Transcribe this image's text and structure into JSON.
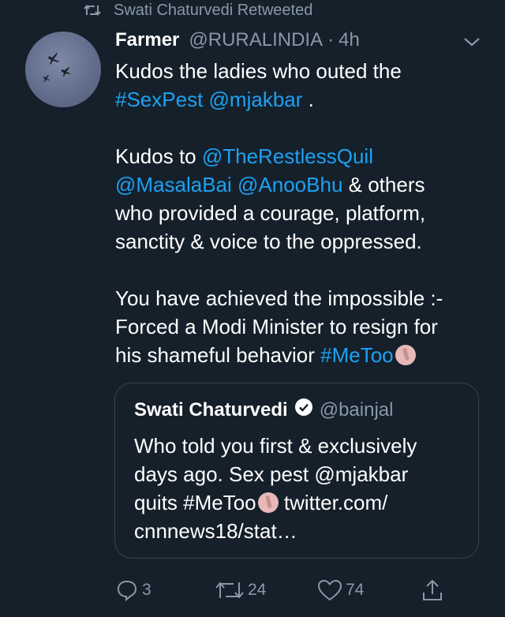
{
  "retweet_context": {
    "label": "Swati Chaturvedi Retweeted",
    "icon": "retweet-icon"
  },
  "tweet": {
    "author_name": "Farmer",
    "author_handle": "@RURALINDIA",
    "separator": "·",
    "time": "4h",
    "menu_icon": "chevron-down-icon",
    "lines": {
      "l1": "Kudos the ladies who outed the",
      "l2_tag": "#SexPest",
      "l2_mention": "@mjakbar",
      "l2_tail": " .",
      "l3_mention": "@TheRestlessQuil",
      "l3_lead": "Kudos to ",
      "l4_mention1": "@MasalaBai",
      "l4_mention2": "@AnooBhu",
      "l4_tail": " & others",
      "l5": "who provided a courage, platform,",
      "l6": "sanctity & voice to the oppressed.",
      "l7": "You have achieved the impossible :-",
      "l8": "Forced a Modi Minister to resign for",
      "l9_lead": "his shameful behavior ",
      "l9_tag": "#MeToo"
    }
  },
  "quoted_tweet": {
    "author_name": "Swati Chaturvedi",
    "author_handle": "@bainjal",
    "verified_icon": "verified-badge-icon",
    "lines": {
      "l1": "Who told you first & exclusively",
      "l2": "days ago. Sex pest @mjakbar",
      "l3_lead": "quits #MeToo",
      "l3_tail": " twitter.com/",
      "l4": "cnnnews18/stat…"
    }
  },
  "actions": {
    "reply_count": "3",
    "retweet_count": "24",
    "like_count": "74"
  },
  "colors": {
    "background": "#15202b",
    "link": "#1da1f2",
    "secondary_text": "#8899a6",
    "border": "#38444d"
  }
}
